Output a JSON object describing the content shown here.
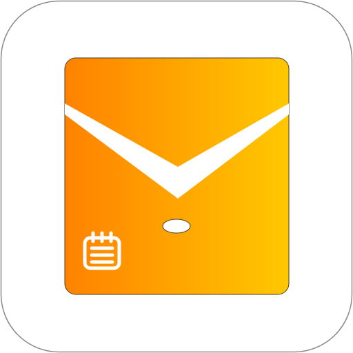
{
  "app_icon": {
    "icon_semantic": "mail-envelope-icon",
    "badge_semantic": "calendar-notepad-icon",
    "colors": {
      "background": "#ffffff",
      "tile_border": "#8a8a8a",
      "envelope_gradient_start": "#ff8200",
      "envelope_gradient_end": "#ffc800",
      "envelope_outline": "#4a3a20",
      "flap_line": "#ffffff",
      "badge_stroke": "#ffffff"
    }
  }
}
